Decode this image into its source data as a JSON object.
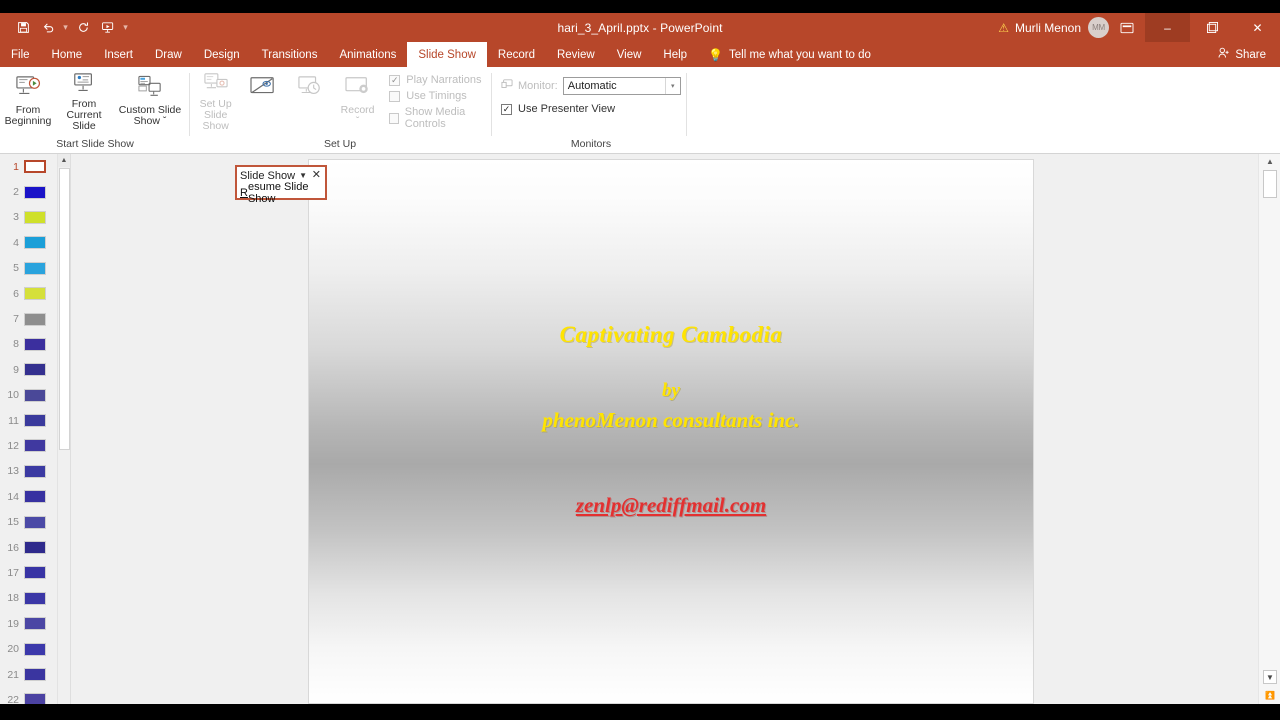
{
  "window": {
    "title": "hari_3_April.pptx  -  PowerPoint",
    "account_name": "Murli Menon",
    "avatar_initials": "MM",
    "warning_icon": "warning-triangle-icon",
    "ribbon_display_icon": "ribbon-display-options-icon",
    "minimize": "–",
    "restore": "❑",
    "close": "✕"
  },
  "quick_access": {
    "items": [
      {
        "name": "save-icon",
        "label": "Save"
      },
      {
        "name": "undo-icon",
        "label": "Undo"
      },
      {
        "name": "redo-icon",
        "label": "Redo"
      },
      {
        "name": "start-from-beginning-icon",
        "label": "Start From Beginning"
      },
      {
        "name": "customize-quick-access-toolbar-icon",
        "label": "≡"
      }
    ]
  },
  "tabs": {
    "items": [
      {
        "label": "File",
        "active": false
      },
      {
        "label": "Home",
        "active": false
      },
      {
        "label": "Insert",
        "active": false
      },
      {
        "label": "Draw",
        "active": false
      },
      {
        "label": "Design",
        "active": false
      },
      {
        "label": "Transitions",
        "active": false
      },
      {
        "label": "Animations",
        "active": false
      },
      {
        "label": "Slide Show",
        "active": true
      },
      {
        "label": "Record",
        "active": false
      },
      {
        "label": "Review",
        "active": false
      },
      {
        "label": "View",
        "active": false
      },
      {
        "label": "Help",
        "active": false
      }
    ],
    "tell_me": "Tell me what you want to do",
    "share": "Share"
  },
  "ribbon": {
    "groups": [
      {
        "label": "Start Slide Show"
      },
      {
        "label": "Set Up"
      },
      {
        "label": "Monitors"
      }
    ],
    "start_slide_show": {
      "from_beginning_line1": "From",
      "from_beginning_line2": "Beginning",
      "from_current_line1": "From",
      "from_current_line2": "Current Slide",
      "custom_line1": "Custom Slide",
      "custom_line2": "Show ˇ"
    },
    "set_up": {
      "set_up_line1": "Set Up",
      "set_up_line2": "Slide Show",
      "hide_slide": "Hide Slide",
      "rehearse_timings": "Rehearse Timings",
      "record_line1": "Record",
      "record_line2": "ˇ",
      "play_narrations": "Play Narrations",
      "use_timings": "Use Timings",
      "show_media_controls": "Show Media Controls"
    },
    "monitors": {
      "monitor_label": "Monitor:",
      "monitor_value": "Automatic",
      "use_presenter_view": "Use Presenter View"
    },
    "collapse_ribbon_icon": "chevron-up-icon"
  },
  "popup": {
    "title": "Slide Show",
    "caret": "▼",
    "close": "✕",
    "item_underlined": "R",
    "item_rest": "esume Slide Show"
  },
  "thumbnails": {
    "selected": 1,
    "slides": [
      {
        "n": "1",
        "color": "#ffffff"
      },
      {
        "n": "2",
        "color": "#1a13c8"
      },
      {
        "n": "3",
        "color": "#cfe02a"
      },
      {
        "n": "4",
        "color": "#1b9fd8"
      },
      {
        "n": "5",
        "color": "#2aa3dd"
      },
      {
        "n": "6",
        "color": "#d5e03a"
      },
      {
        "n": "7",
        "color": "#8e8e8e"
      },
      {
        "n": "8",
        "color": "#3b2f9e"
      },
      {
        "n": "9",
        "color": "#34308f"
      },
      {
        "n": "10",
        "color": "#4a4898"
      },
      {
        "n": "11",
        "color": "#3a3a9c"
      },
      {
        "n": "12",
        "color": "#4039a0"
      },
      {
        "n": "13",
        "color": "#3b3aa2"
      },
      {
        "n": "14",
        "color": "#3832a1"
      },
      {
        "n": "15",
        "color": "#4b4aa6"
      },
      {
        "n": "16",
        "color": "#2f2a8c"
      },
      {
        "n": "17",
        "color": "#3834a4"
      },
      {
        "n": "18",
        "color": "#3b37a6"
      },
      {
        "n": "19",
        "color": "#4b46a4"
      },
      {
        "n": "20",
        "color": "#3c39ab"
      },
      {
        "n": "21",
        "color": "#3a35a0"
      },
      {
        "n": "22",
        "color": "#4b42a2"
      }
    ]
  },
  "slide": {
    "title": "Captivating Cambodia",
    "by": "by",
    "organization": "phenoMenon consultants inc.",
    "email": "zenlp@rediffmail.com",
    "title_color": "#ffe400",
    "email_color": "#e33030"
  },
  "scrollbars": {
    "up_arrow": "▲",
    "down_arrow": "▼",
    "prev_slide": "≡",
    "next_slide": "≡"
  }
}
